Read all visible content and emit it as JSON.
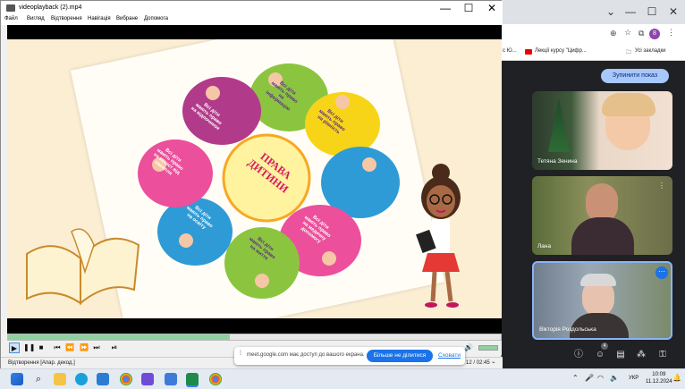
{
  "player": {
    "title": "videoplayback (2).mp4",
    "menu": [
      "Файл",
      "Вигляд",
      "Відтворення",
      "Навігація",
      "Вибране",
      "Допомога"
    ],
    "status_left": "Відтворення [Апар. декод.]",
    "time": "12 / 02:45",
    "progress": 0.45
  },
  "slide": {
    "center_text": "ПРАВА ДИТИНИ",
    "petals": [
      "Всі діти мають право на інформацію",
      "Всі діти мають право на відпочинок",
      "Всі діти мають право на захист від насилля",
      "Всі діти мають право на освіту",
      "Всі діти мають право на рівність",
      "Всі діти мають право на медичну допомогу",
      "Всі діти мають право на життя"
    ]
  },
  "browser": {
    "bookmarks": [
      "с Ю...",
      "Лекції курсу \"Цифр...",
      "Усі закладки"
    ],
    "avatar_letter": "8"
  },
  "meet": {
    "stop_presenting": "Зупинити показ",
    "participants": [
      {
        "name": "Тетяна Зенина"
      },
      {
        "name": "Лана"
      },
      {
        "name": "Вікторія Роздольська"
      }
    ],
    "participants_badge": "4"
  },
  "share_notice": {
    "text": "meet.google.com має доступ до вашого екрана.",
    "stop_label": "Більше не ділитися",
    "hide_label": "Сховати"
  },
  "taskbar": {
    "lang": "УКР",
    "time": "10:09",
    "date": "11.12.2024"
  },
  "colors": {
    "accent": "#1a73e8",
    "meet_bg": "#202124",
    "progress": "#8fd19e"
  }
}
